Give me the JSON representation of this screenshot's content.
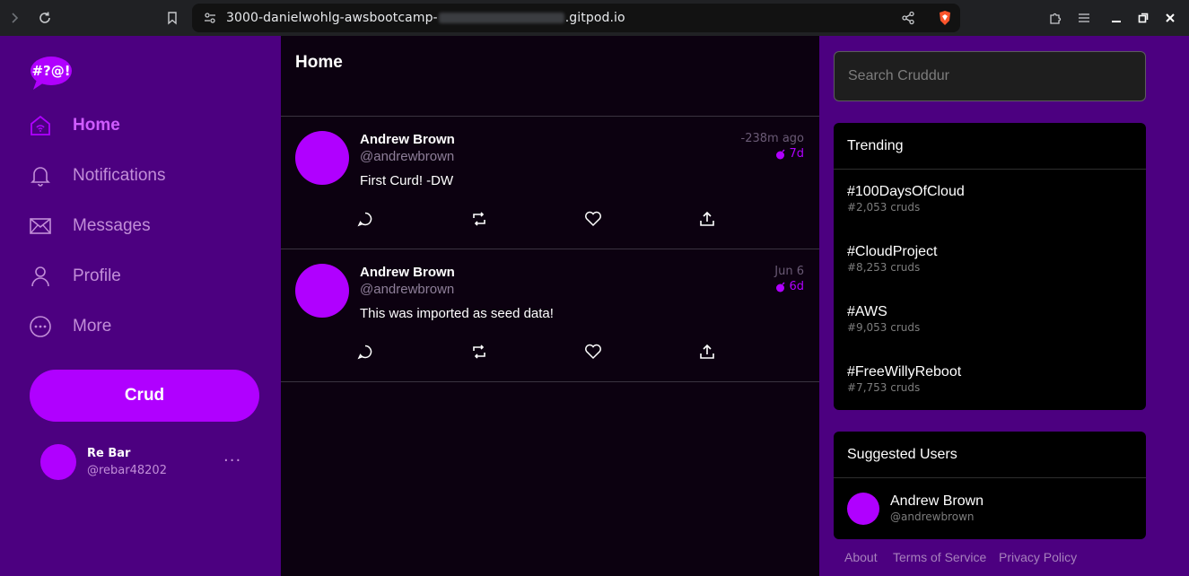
{
  "browser": {
    "url_prefix": "3000-danielwohlg-awsbootcamp-",
    "url_suffix": ".gitpod.io"
  },
  "sidebar": {
    "logo_text": "#?@!",
    "items": [
      {
        "label": "Home",
        "icon": "home-icon",
        "active": true
      },
      {
        "label": "Notifications",
        "icon": "bell-icon",
        "active": false
      },
      {
        "label": "Messages",
        "icon": "mail-icon",
        "active": false
      },
      {
        "label": "Profile",
        "icon": "user-icon",
        "active": false
      },
      {
        "label": "More",
        "icon": "more-circle-icon",
        "active": false
      }
    ],
    "crud_label": "Crud",
    "user": {
      "name": "Re Bar",
      "handle": "@rebar48202",
      "menu": "···"
    }
  },
  "feed": {
    "title": "Home",
    "posts": [
      {
        "name": "Andrew Brown",
        "handle": "@andrewbrown",
        "message": "First Curd! -DW",
        "time": "-238m ago",
        "expires": "7d"
      },
      {
        "name": "Andrew Brown",
        "handle": "@andrewbrown",
        "message": "This was imported as seed data!",
        "time": "Jun 6",
        "expires": "6d"
      }
    ]
  },
  "search": {
    "placeholder": "Search Cruddur"
  },
  "trending": {
    "title": "Trending",
    "items": [
      {
        "name": "#100DaysOfCloud",
        "count": "#2,053 cruds"
      },
      {
        "name": "#CloudProject",
        "count": "#8,253 cruds"
      },
      {
        "name": "#AWS",
        "count": "#9,053 cruds"
      },
      {
        "name": "#FreeWillyReboot",
        "count": "#7,753 cruds"
      }
    ]
  },
  "suggested": {
    "title": "Suggested Users",
    "users": [
      {
        "name": "Andrew Brown",
        "handle": "@andrewbrown"
      }
    ]
  },
  "footer": {
    "about": "About",
    "terms": "Terms of Service",
    "privacy": "Privacy Policy"
  },
  "colors": {
    "accent": "#b000ff",
    "sidebar_bg": "#4c0080",
    "feed_bg": "#0c0110"
  }
}
